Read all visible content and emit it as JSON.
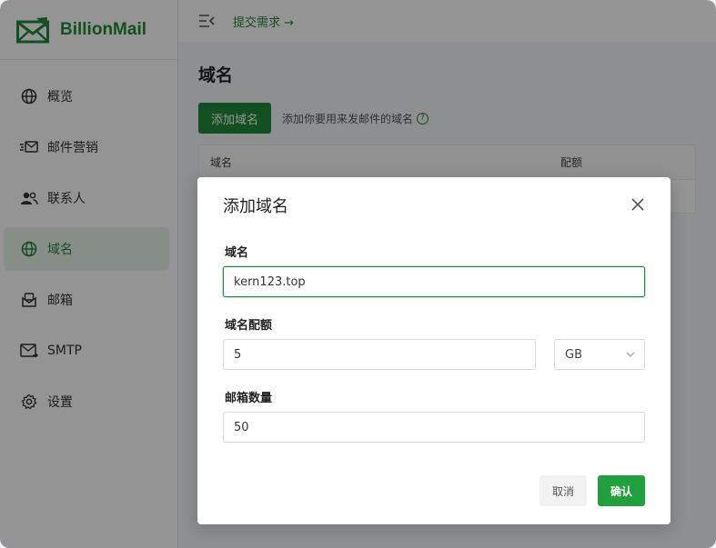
{
  "app": {
    "name": "BillionMail"
  },
  "sidebar": {
    "items": [
      {
        "label": "概览",
        "icon": "globe-icon"
      },
      {
        "label": "邮件营销",
        "icon": "mail-send-icon"
      },
      {
        "label": "联系人",
        "icon": "contacts-icon"
      },
      {
        "label": "域名",
        "icon": "globe-icon",
        "active": true
      },
      {
        "label": "邮箱",
        "icon": "mailbox-icon"
      },
      {
        "label": "SMTP",
        "icon": "smtp-icon"
      },
      {
        "label": "设置",
        "icon": "gear-icon"
      }
    ]
  },
  "topbar": {
    "submit_link": "提交需求 →"
  },
  "page": {
    "title": "域名",
    "add_button": "添加域名",
    "hint": "添加你要用来发邮件的域名",
    "table_headers": [
      "域名",
      "配额"
    ]
  },
  "modal": {
    "title": "添加域名",
    "fields": {
      "domain": {
        "label": "域名",
        "value": "kern123.top"
      },
      "quota": {
        "label": "域名配额",
        "value": "5",
        "unit": "GB"
      },
      "mailbox_count": {
        "label": "邮箱数量",
        "value": "50"
      }
    },
    "cancel": "取消",
    "confirm": "确认"
  },
  "colors": {
    "brand": "#1f8a3a",
    "confirm": "#21a03e"
  }
}
